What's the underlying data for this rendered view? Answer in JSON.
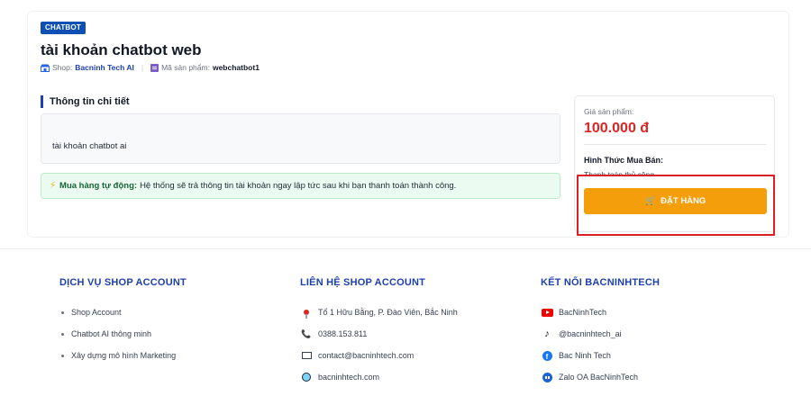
{
  "product": {
    "badge": "CHATBOT",
    "title": "tài khoản chatbot web",
    "shop_label": "Shop:",
    "shop_name": "Bacninh Tech AI",
    "separator": "|",
    "code_label": "Mã sản phẩm:",
    "code_value": "webchatbot1"
  },
  "details": {
    "title": "Thông tin chi tiết",
    "description": "tài khoản chatbot ai"
  },
  "auto_notice": {
    "icon": "⚡",
    "strong": "Mua hàng tự động:",
    "text": "Hệ thống sẽ trả thông tin tài khoản ngay lập tức sau khi bạn thanh toán thành công."
  },
  "pricing": {
    "price_label": "Giá sản phẩm:",
    "price": "100.000 đ",
    "buy_type_label": "Hình Thức Mua Bán:",
    "buy_type_value": "Thanh toán thủ công",
    "order_icon": "🛒",
    "order_button": "ĐẶT HÀNG"
  },
  "footer": {
    "services": {
      "title": "DỊCH VỤ SHOP ACCOUNT",
      "items": [
        "Shop Account",
        "Chatbot AI thông minh",
        "Xây dựng mô hình Marketing"
      ]
    },
    "contact": {
      "title": "LIÊN HỆ SHOP ACCOUNT",
      "address": "Tổ 1 Hữu Bằng, P. Đào Viên, Bắc Ninh",
      "phone_icon": "📞",
      "phone": "0388.153.811",
      "email": "contact@bacninhtech.com",
      "website": "bacninhtech.com"
    },
    "social": {
      "title": "KẾT NỐI BACNINHTECH",
      "youtube": "BacNinhTech",
      "tiktok_icon": "♪",
      "tiktok": "@bacninhtech_ai",
      "facebook_icon": "f",
      "facebook": "Bac Ninh Tech",
      "zalo": "Zalo OA BacNinhTech"
    }
  },
  "colors": {
    "brand_blue": "#1e40af",
    "price_red": "#dc2626",
    "order_orange": "#f59e0b",
    "highlight_red": "#dc1f26"
  }
}
